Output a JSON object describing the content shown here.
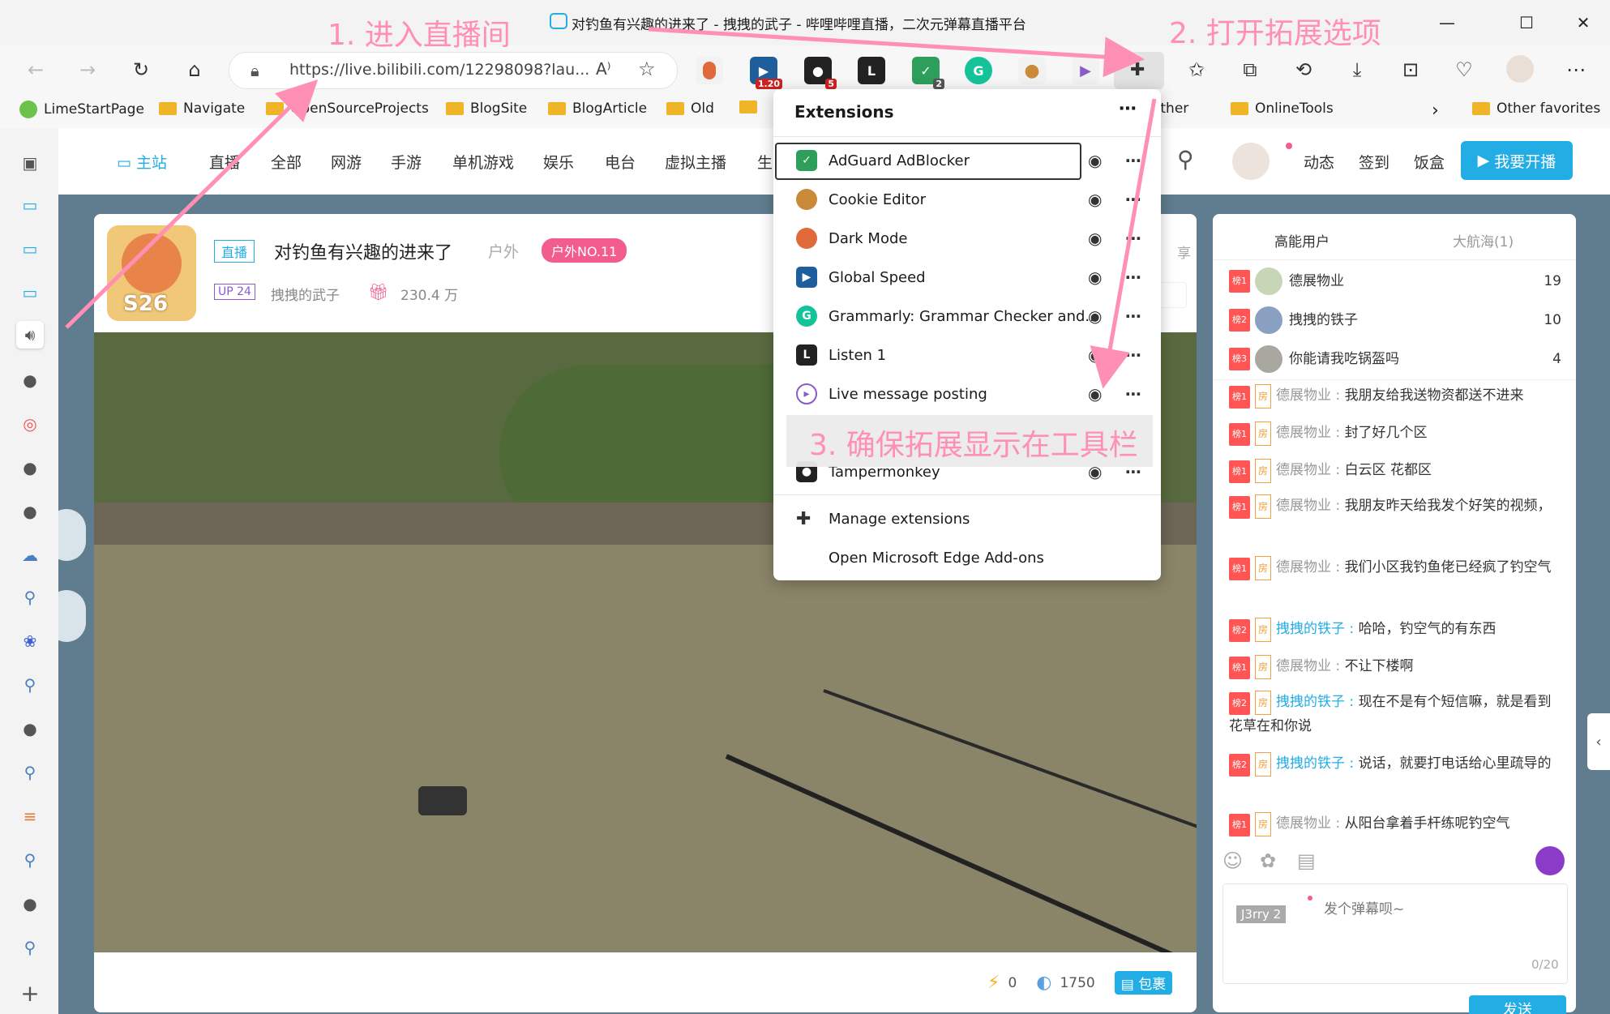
{
  "window": {
    "title": "对钓鱼有兴趣的进来了 - 拽拽的武子 - 哔哩哔哩直播，二次元弹幕直播平台",
    "minimize": "—",
    "maximize": "☐",
    "close": "✕"
  },
  "toolbar": {
    "url": "https://live.bilibili.com/12298098?lau...",
    "extension_badges": {
      "global_speed": "1.20",
      "tampermonkey": "5",
      "adguard": "2"
    }
  },
  "favorites": [
    "LimeStartPage",
    "Navigate",
    "OpenSourceProjects",
    "BlogSite",
    "BlogArticle",
    "Old",
    "Other",
    "OnlineTools",
    "Other favorites"
  ],
  "bili_nav": {
    "items": [
      "主站",
      "直播",
      "全部",
      "网游",
      "手游",
      "单机游戏",
      "娱乐",
      "电台",
      "虚拟主播",
      "生"
    ],
    "right": [
      "动态",
      "签到",
      "饭盒"
    ],
    "start_live": "我要开播"
  },
  "room": {
    "live_tag": "直播",
    "title": "对钓鱼有兴趣的进来了",
    "category": "户外",
    "rank_badge": "户外NO.11",
    "up_level": "UP 24",
    "streamer": "拽拽的武子",
    "popularity": "230.4 万",
    "avatar_label": "S26",
    "share": "享",
    "bottom": {
      "battery": "0",
      "coins": "1750",
      "package": "包裹"
    }
  },
  "chat": {
    "tabs": [
      "高能用户",
      "大航海(1)"
    ],
    "top_users": [
      {
        "rank": "榜1",
        "name": "德展物业",
        "score": "19"
      },
      {
        "rank": "榜2",
        "name": "拽拽的铁子",
        "score": "10"
      },
      {
        "rank": "榜3",
        "name": "你能请我吃锅盔吗",
        "score": "4"
      }
    ],
    "fang": "房",
    "messages": [
      {
        "rank": "榜1",
        "user": "德展物业",
        "text": "我朋友给我送物资都送不进来"
      },
      {
        "rank": "榜1",
        "user": "德展物业",
        "text": "封了好几个区"
      },
      {
        "rank": "榜1",
        "user": "德展物业",
        "text": "白云区 花都区"
      },
      {
        "rank": "榜1",
        "user": "德展物业",
        "text": "我朋友昨天给我发个好笑的视频，"
      },
      {
        "rank": "榜1",
        "user": "德展物业",
        "text": "我们小区我钓鱼佬已经疯了钓空气"
      },
      {
        "rank": "榜2",
        "user": "拽拽的铁子",
        "text": "哈哈，钓空气的有东西"
      },
      {
        "rank": "榜1",
        "user": "德展物业",
        "text": "不让下楼啊"
      },
      {
        "rank": "榜2",
        "user": "拽拽的铁子",
        "text": "现在不是有个短信嘛，就是看到花草在和你说"
      },
      {
        "rank": "榜2",
        "user": "拽拽的铁子",
        "text": "说话，就要打电话给心里疏导的"
      },
      {
        "rank": "榜1",
        "user": "德展物业",
        "text": "从阳台拿着手杆练呢钓空气"
      }
    ],
    "input_placeholder": "发个弹幕呗~",
    "counter": "0/20",
    "user_badge": "J3rry 2",
    "send": "发送"
  },
  "extensions_popup": {
    "title": "Extensions",
    "items": [
      {
        "name": "AdGuard AdBlocker",
        "color": "#2e9e5b"
      },
      {
        "name": "Cookie Editor",
        "color": "#c98a3a"
      },
      {
        "name": "Dark Mode",
        "color": "#e06a3a"
      },
      {
        "name": "Global Speed",
        "color": "#1f5e9c"
      },
      {
        "name": "Grammarly: Grammar Checker and...",
        "color": "#15c39a"
      },
      {
        "name": "Listen 1",
        "color": "#222222"
      },
      {
        "name": "Live message posting",
        "color": "#8a5cc9"
      },
      {
        "name": "Tampermonkey",
        "color": "#222222"
      }
    ],
    "manage": "Manage extensions",
    "addons": "Open Microsoft Edge Add-ons"
  },
  "annotations": {
    "step1": "1. 进入直播间",
    "step2": "2. 打开拓展选项",
    "step3": "3. 确保拓展显示在工具栏"
  },
  "colors": {
    "accent": "#23ade5",
    "pink": "#ff8fb5",
    "edge_blue": "#0067c0"
  }
}
